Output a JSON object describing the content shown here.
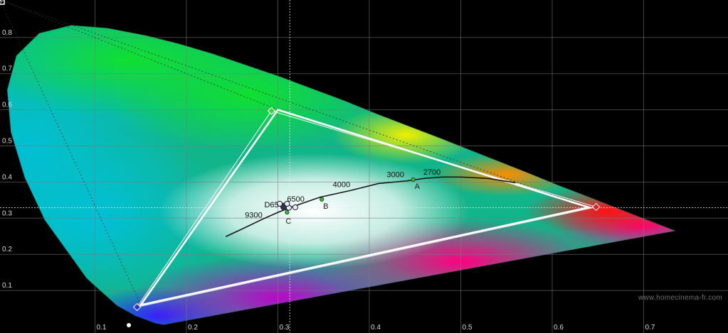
{
  "chart_data": {
    "type": "scatter",
    "title": "",
    "xlabel": "",
    "ylabel": "",
    "xlim": [
      0.0,
      0.8
    ],
    "ylim": [
      0.0,
      0.9
    ],
    "grid": true,
    "x_ticks": [
      "0.1",
      "0.2",
      "0.3",
      "0.4",
      "0.5",
      "0.6",
      "0.7"
    ],
    "y_ticks": [
      "0.1",
      "0.2",
      "0.3",
      "0.4",
      "0.5",
      "0.6",
      "0.7",
      "0.8"
    ],
    "spectral_locus": [
      [
        0.175,
        0.005
      ],
      [
        0.166,
        0.009
      ],
      [
        0.144,
        0.03
      ],
      [
        0.124,
        0.058
      ],
      [
        0.091,
        0.133
      ],
      [
        0.045,
        0.295
      ],
      [
        0.023,
        0.413
      ],
      [
        0.008,
        0.538
      ],
      [
        0.004,
        0.655
      ],
      [
        0.014,
        0.75
      ],
      [
        0.039,
        0.812
      ],
      [
        0.074,
        0.834
      ],
      [
        0.114,
        0.826
      ],
      [
        0.155,
        0.806
      ],
      [
        0.193,
        0.782
      ],
      [
        0.23,
        0.754
      ],
      [
        0.265,
        0.724
      ],
      [
        0.302,
        0.692
      ],
      [
        0.337,
        0.659
      ],
      [
        0.373,
        0.625
      ],
      [
        0.408,
        0.589
      ],
      [
        0.444,
        0.554
      ],
      [
        0.479,
        0.52
      ],
      [
        0.512,
        0.487
      ],
      [
        0.547,
        0.452
      ],
      [
        0.575,
        0.424
      ],
      [
        0.608,
        0.39
      ],
      [
        0.64,
        0.359
      ],
      [
        0.665,
        0.334
      ],
      [
        0.692,
        0.307
      ],
      [
        0.735,
        0.265
      ]
    ],
    "series": [
      {
        "name": "",
        "kind": "target_gamut",
        "points": [
          [
            0.64,
            0.33
          ],
          [
            0.3,
            0.6
          ],
          [
            0.15,
            0.06
          ]
        ]
      },
      {
        "name": "",
        "kind": "measured_gamut",
        "points": [
          [
            0.648,
            0.331
          ],
          [
            0.293,
            0.597
          ],
          [
            0.146,
            0.054
          ]
        ]
      },
      {
        "name": "",
        "kind": "blackbody_locus",
        "points": [
          [
            0.243,
            0.249
          ],
          [
            0.265,
            0.275
          ],
          [
            0.283,
            0.297
          ],
          [
            0.3,
            0.316
          ],
          [
            0.313,
            0.329
          ],
          [
            0.346,
            0.358
          ],
          [
            0.38,
            0.377
          ],
          [
            0.41,
            0.396
          ],
          [
            0.44,
            0.403
          ],
          [
            0.46,
            0.41
          ],
          [
            0.48,
            0.414
          ],
          [
            0.5,
            0.414
          ],
          [
            0.53,
            0.41
          ],
          [
            0.56,
            0.398
          ]
        ]
      }
    ],
    "markers": {
      "white_targets": [
        {
          "name": "A",
          "x": 0.448,
          "y": 0.407
        },
        {
          "name": "B",
          "x": 0.348,
          "y": 0.352
        },
        {
          "name": "C",
          "x": 0.31,
          "y": 0.316
        }
      ],
      "white_measured": [
        {
          "x": 0.307,
          "y": 0.332
        },
        {
          "x": 0.312,
          "y": 0.329
        },
        {
          "x": 0.319,
          "y": 0.33
        },
        {
          "x": 0.31,
          "y": 0.34
        },
        {
          "x": 0.302,
          "y": 0.34
        }
      ],
      "secondary_measured": [
        {
          "x": 0.225,
          "y": 0.341
        },
        {
          "x": 0.39,
          "y": 0.512
        },
        {
          "x": 0.321,
          "y": 0.152
        },
        {
          "x": 0.393,
          "y": 0.24
        }
      ],
      "secondary_targets": [
        {
          "x": 0.225,
          "y": 0.329
        },
        {
          "x": 0.419,
          "y": 0.505
        },
        {
          "x": 0.321,
          "y": 0.154
        }
      ],
      "cct_points": [
        {
          "x": 0.283,
          "y": 0.297
        },
        {
          "x": 0.313,
          "y": 0.329
        },
        {
          "x": 0.32,
          "y": 0.335
        },
        {
          "x": 0.38,
          "y": 0.377
        },
        {
          "x": 0.436,
          "y": 0.404
        },
        {
          "x": 0.46,
          "y": 0.411
        }
      ],
      "white_point_label": "D65",
      "cct_labels": [
        {
          "text": "9300",
          "x": 0.264,
          "y": 0.302
        },
        {
          "text": "6500",
          "x": 0.31,
          "y": 0.346
        },
        {
          "text": "4000",
          "x": 0.36,
          "y": 0.386
        },
        {
          "text": "3000",
          "x": 0.419,
          "y": 0.414
        },
        {
          "text": "2700",
          "x": 0.459,
          "y": 0.42
        }
      ]
    },
    "crosshair": {
      "x": 0.313,
      "y": 0.329
    }
  },
  "watermark": "www.homecinema-fr.com"
}
